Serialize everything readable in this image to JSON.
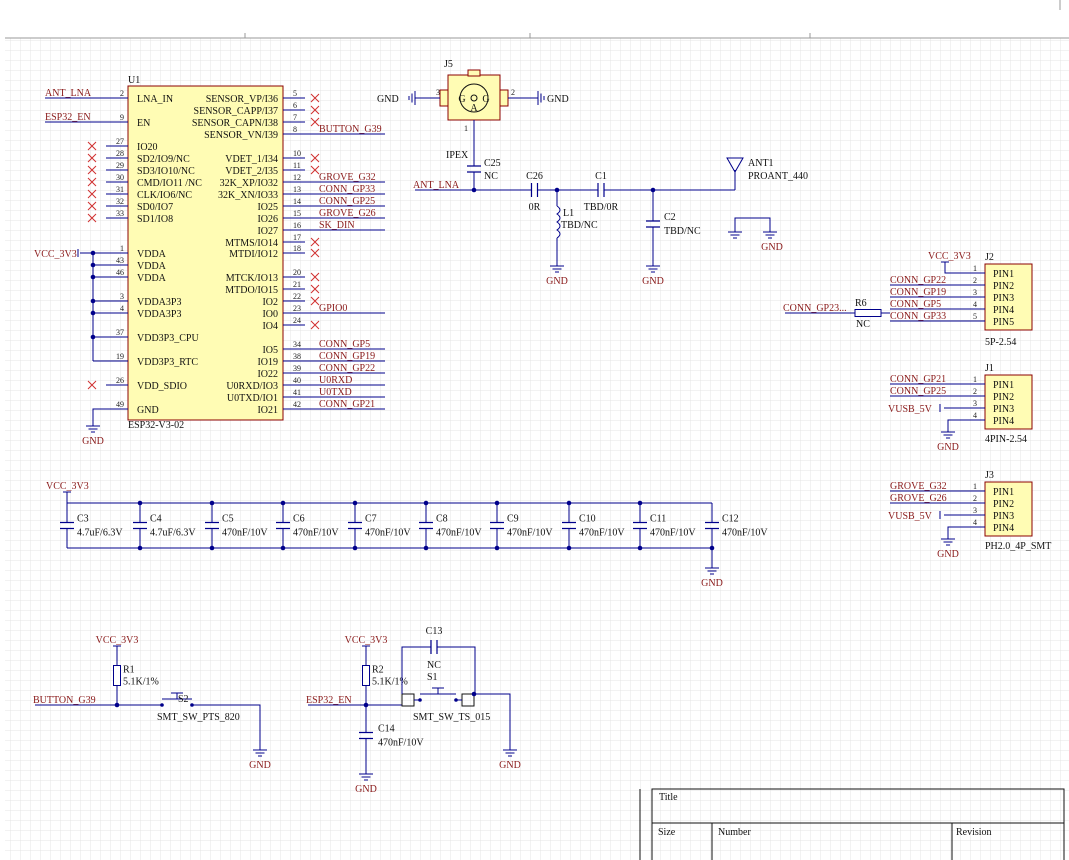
{
  "colors": {
    "wire": "#00008b",
    "part_fill": "#fffcb4",
    "part_border": "#8b0000",
    "net_label": "#8b0000",
    "grid": "#e2e2e2",
    "nc_mark": "#d03030"
  },
  "u1": {
    "ref": "U1",
    "part": "ESP32-V3-02",
    "left_pins": [
      {
        "num": "2",
        "name": "LNA_IN"
      },
      {
        "num": "9",
        "name": "EN"
      },
      {
        "num": "27",
        "name": "IO20"
      },
      {
        "num": "28",
        "name": "SD2/IO9/NC"
      },
      {
        "num": "29",
        "name": "SD3/IO10/NC"
      },
      {
        "num": "30",
        "name": "CMD/IO11 /NC"
      },
      {
        "num": "31",
        "name": "CLK/IO6/NC"
      },
      {
        "num": "32",
        "name": "SD0/IO7"
      },
      {
        "num": "33",
        "name": "SD1/IO8"
      },
      {
        "num": "1",
        "name": "VDDA"
      },
      {
        "num": "43",
        "name": "VDDA"
      },
      {
        "num": "46",
        "name": "VDDA"
      },
      {
        "num": "3",
        "name": "VDDA3P3"
      },
      {
        "num": "4",
        "name": "VDDA3P3"
      },
      {
        "num": "37",
        "name": "VDD3P3_CPU"
      },
      {
        "num": "19",
        "name": "VDD3P3_RTC"
      },
      {
        "num": "26",
        "name": "VDD_SDIO"
      },
      {
        "num": "49",
        "name": "GND"
      }
    ],
    "right_pins": [
      {
        "num": "5",
        "name": "SENSOR_VP/I36",
        "net": ""
      },
      {
        "num": "6",
        "name": "SENSOR_CAPP/I37",
        "net": ""
      },
      {
        "num": "7",
        "name": "SENSOR_CAPN/I38",
        "net": ""
      },
      {
        "num": "8",
        "name": "SENSOR_VN/I39",
        "net": "BUTTON_G39"
      },
      {
        "num": "10",
        "name": "VDET_1/I34",
        "net": ""
      },
      {
        "num": "11",
        "name": "VDET_2/I35",
        "net": ""
      },
      {
        "num": "12",
        "name": "32K_XP/IO32",
        "net": "GROVE_G32"
      },
      {
        "num": "13",
        "name": "32K_XN/IO33",
        "net": "CONN_GP33"
      },
      {
        "num": "14",
        "name": "IO25",
        "net": "CONN_GP25"
      },
      {
        "num": "15",
        "name": "IO26",
        "net": "GROVE_G26"
      },
      {
        "num": "16",
        "name": "IO27",
        "net": "SK_DIN"
      },
      {
        "num": "17",
        "name": "MTMS/IO14",
        "net": ""
      },
      {
        "num": "18",
        "name": "MTDI/IO12",
        "net": ""
      },
      {
        "num": "20",
        "name": "MTCK/IO13",
        "net": ""
      },
      {
        "num": "21",
        "name": "MTDO/IO15",
        "net": ""
      },
      {
        "num": "22",
        "name": "IO2",
        "net": ""
      },
      {
        "num": "23",
        "name": "IO0",
        "net": "GPIO0"
      },
      {
        "num": "24",
        "name": "IO4",
        "net": ""
      },
      {
        "num": "34",
        "name": "IO5",
        "net": "CONN_GP5"
      },
      {
        "num": "38",
        "name": "IO19",
        "net": "CONN_GP19"
      },
      {
        "num": "39",
        "name": "IO22",
        "net": "CONN_GP22"
      },
      {
        "num": "40",
        "name": "U0RXD/IO3",
        "net": "U0RXD"
      },
      {
        "num": "41",
        "name": "U0TXD/IO1",
        "net": "U0TXD"
      },
      {
        "num": "42",
        "name": "IO21",
        "net": "CONN_GP21"
      }
    ],
    "net_ant": "ANT_LNA",
    "net_en": "ESP32_EN",
    "net_vcc": "VCC_3V3",
    "net_gnd": "GND"
  },
  "rf": {
    "j5_ref": "J5",
    "j5_note": "IPEX",
    "j5_pin_left": "3",
    "j5_pin_right": "2",
    "j5_pin_bottom": "1",
    "j5_glyph": "G",
    "j5_glyph2": "A",
    "gnd": "GND",
    "ant_net": "ANT_LNA",
    "c25_ref": "C25",
    "c25_val": "NC",
    "c26_ref": "C26",
    "c26_val": "0R",
    "l1_ref": "L1",
    "l1_val": "TBD/NC",
    "c1_ref": "C1",
    "c1_val": "TBD/0R",
    "c2_ref": "C2",
    "c2_val": "TBD/NC",
    "ant1_ref": "ANT1",
    "ant1_val": "PROANT_440"
  },
  "j2": {
    "ref": "J2",
    "part": "5P-2.54",
    "vcc": "VCC_3V3",
    "pins": [
      {
        "num": "1",
        "name": "PIN1",
        "net": ""
      },
      {
        "num": "2",
        "name": "PIN2",
        "net": "CONN_GP22"
      },
      {
        "num": "3",
        "name": "PIN3",
        "net": "CONN_GP19"
      },
      {
        "num": "4",
        "name": "PIN4",
        "net": "CONN_GP5"
      },
      {
        "num": "5",
        "name": "PIN5",
        "net": "CONN_GP33"
      }
    ],
    "r6_ref": "R6",
    "r6_val": "NC",
    "r6_net": "CONN_GP23..."
  },
  "j1": {
    "ref": "J1",
    "part": "4PIN-2.54",
    "vusb": "VUSB_5V",
    "gnd": "GND",
    "pins": [
      {
        "num": "1",
        "name": "PIN1",
        "net": "CONN_GP21"
      },
      {
        "num": "2",
        "name": "PIN2",
        "net": "CONN_GP25"
      },
      {
        "num": "3",
        "name": "PIN3",
        "net": ""
      },
      {
        "num": "4",
        "name": "PIN4",
        "net": ""
      }
    ]
  },
  "j3": {
    "ref": "J3",
    "part": "PH2.0_4P_SMT",
    "vusb": "VUSB_5V",
    "gnd": "GND",
    "pins": [
      {
        "num": "1",
        "name": "PIN1",
        "net": "GROVE_G32"
      },
      {
        "num": "2",
        "name": "PIN2",
        "net": "GROVE_G26"
      },
      {
        "num": "3",
        "name": "PIN3",
        "net": ""
      },
      {
        "num": "4",
        "name": "PIN4",
        "net": ""
      }
    ]
  },
  "decoupling": {
    "vcc": "VCC_3V3",
    "gnd": "GND",
    "caps": [
      {
        "ref": "C3",
        "val": "4.7uF/6.3V"
      },
      {
        "ref": "C4",
        "val": "4.7uF/6.3V"
      },
      {
        "ref": "C5",
        "val": "470nF/10V"
      },
      {
        "ref": "C6",
        "val": "470nF/10V"
      },
      {
        "ref": "C7",
        "val": "470nF/10V"
      },
      {
        "ref": "C8",
        "val": "470nF/10V"
      },
      {
        "ref": "C9",
        "val": "470nF/10V"
      },
      {
        "ref": "C10",
        "val": "470nF/10V"
      },
      {
        "ref": "C11",
        "val": "470nF/10V"
      },
      {
        "ref": "C12",
        "val": "470nF/10V"
      }
    ]
  },
  "btn_boot": {
    "vcc": "VCC_3V3",
    "r_ref": "R1",
    "r_val": "5.1K/1%",
    "sw_ref": "S2",
    "sw_part": "SMT_SW_PTS_820",
    "net": "BUTTON_G39",
    "gnd": "GND"
  },
  "btn_en": {
    "vcc": "VCC_3V3",
    "r_ref": "R2",
    "r_val": "5.1K/1%",
    "sw_ref": "S1",
    "sw_part": "SMT_SW_TS_015",
    "net": "ESP32_EN",
    "c13_ref": "C13",
    "c13_val": "NC",
    "c14_ref": "C14",
    "c14_val": "470nF/10V",
    "gnd": "GND"
  },
  "title_block": {
    "title": "Title",
    "size": "Size",
    "number": "Number",
    "revision": "Revision"
  }
}
